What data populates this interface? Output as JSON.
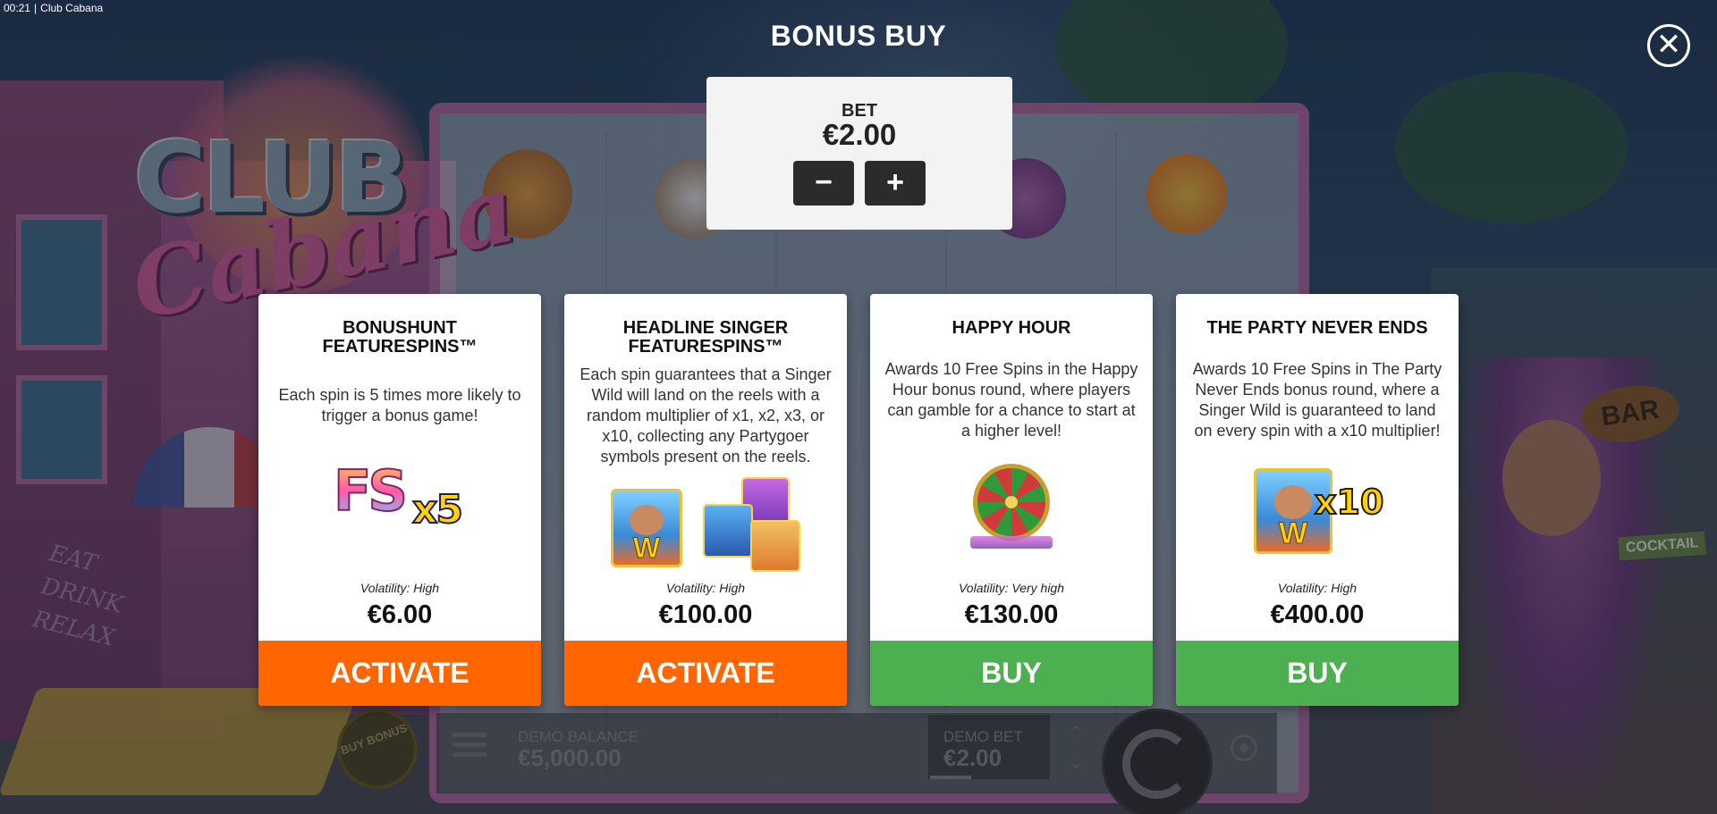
{
  "status": {
    "time": "00:21",
    "app_title": "Club Cabana"
  },
  "background": {
    "logo_line1": "CLUB",
    "logo_line2": "Cabana",
    "bar_sign": "BAR",
    "cocktail_sign": "COCKTAIL",
    "wall_text": [
      "EAT",
      "DRINK",
      "RELAX"
    ]
  },
  "dialog": {
    "title": "BONUS BUY",
    "close_icon": "close-icon",
    "bet": {
      "label": "BET",
      "value": "€2.00",
      "minus": "−",
      "plus": "+"
    }
  },
  "cards": [
    {
      "title": "BONUSHUNT FEATURESPINS™",
      "description": "Each spin is 5 times more likely to trigger a bonus game!",
      "image_text": {
        "main": "FS",
        "mult": "x5"
      },
      "volatility": "Volatility: High",
      "price": "€6.00",
      "button": "ACTIVATE",
      "button_color": "#ff6600"
    },
    {
      "title": "HEADLINE SINGER FEATURESPINS™",
      "description": "Each spin guarantees that a Singer Wild will land on the reels with a random multiplier of x1, x2, x3, or x10, collecting any Partygoer symbols present on the reels.",
      "image_text": {
        "wild": "W"
      },
      "volatility": "Volatility: High",
      "price": "€100.00",
      "button": "ACTIVATE",
      "button_color": "#ff6600"
    },
    {
      "title": "HAPPY HOUR",
      "description": "Awards 10 Free Spins in the Happy Hour bonus round, where players can gamble for a chance to start at a higher level!",
      "volatility": "Volatility: Very high",
      "price": "€130.00",
      "button": "BUY",
      "button_color": "#4caf50"
    },
    {
      "title": "THE PARTY NEVER ENDS",
      "description": "Awards 10 Free Spins in The Party Never Ends bonus round, where a Singer Wild is guaranteed to land on every spin with a x10 multiplier!",
      "image_text": {
        "wild": "W",
        "mult": "x10"
      },
      "volatility": "Volatility: High",
      "price": "€400.00",
      "button": "BUY",
      "button_color": "#4caf50"
    }
  ],
  "bottom_bar": {
    "buy_bonus": "BUY BONUS",
    "balance_label": "DEMO BALANCE",
    "balance_value": "€5,000.00",
    "bet_label": "DEMO BET",
    "bet_value": "€2.00"
  }
}
